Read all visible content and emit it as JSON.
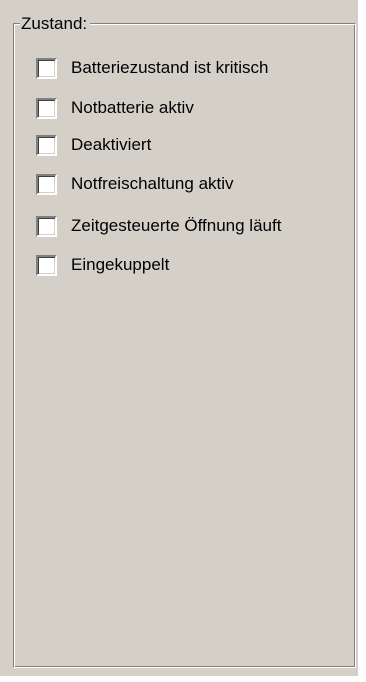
{
  "groupbox": {
    "title": "Zustand:",
    "items": [
      {
        "label": "Batteriezustand ist kritisch",
        "checked": false
      },
      {
        "label": "Notbatterie aktiv",
        "checked": false
      },
      {
        "label": "Deaktiviert",
        "checked": false
      },
      {
        "label": "Notfreischaltung aktiv",
        "checked": false
      },
      {
        "label": "Zeitgesteuerte Öffnung läuft",
        "checked": false
      },
      {
        "label": "Eingekuppelt",
        "checked": false
      }
    ]
  }
}
